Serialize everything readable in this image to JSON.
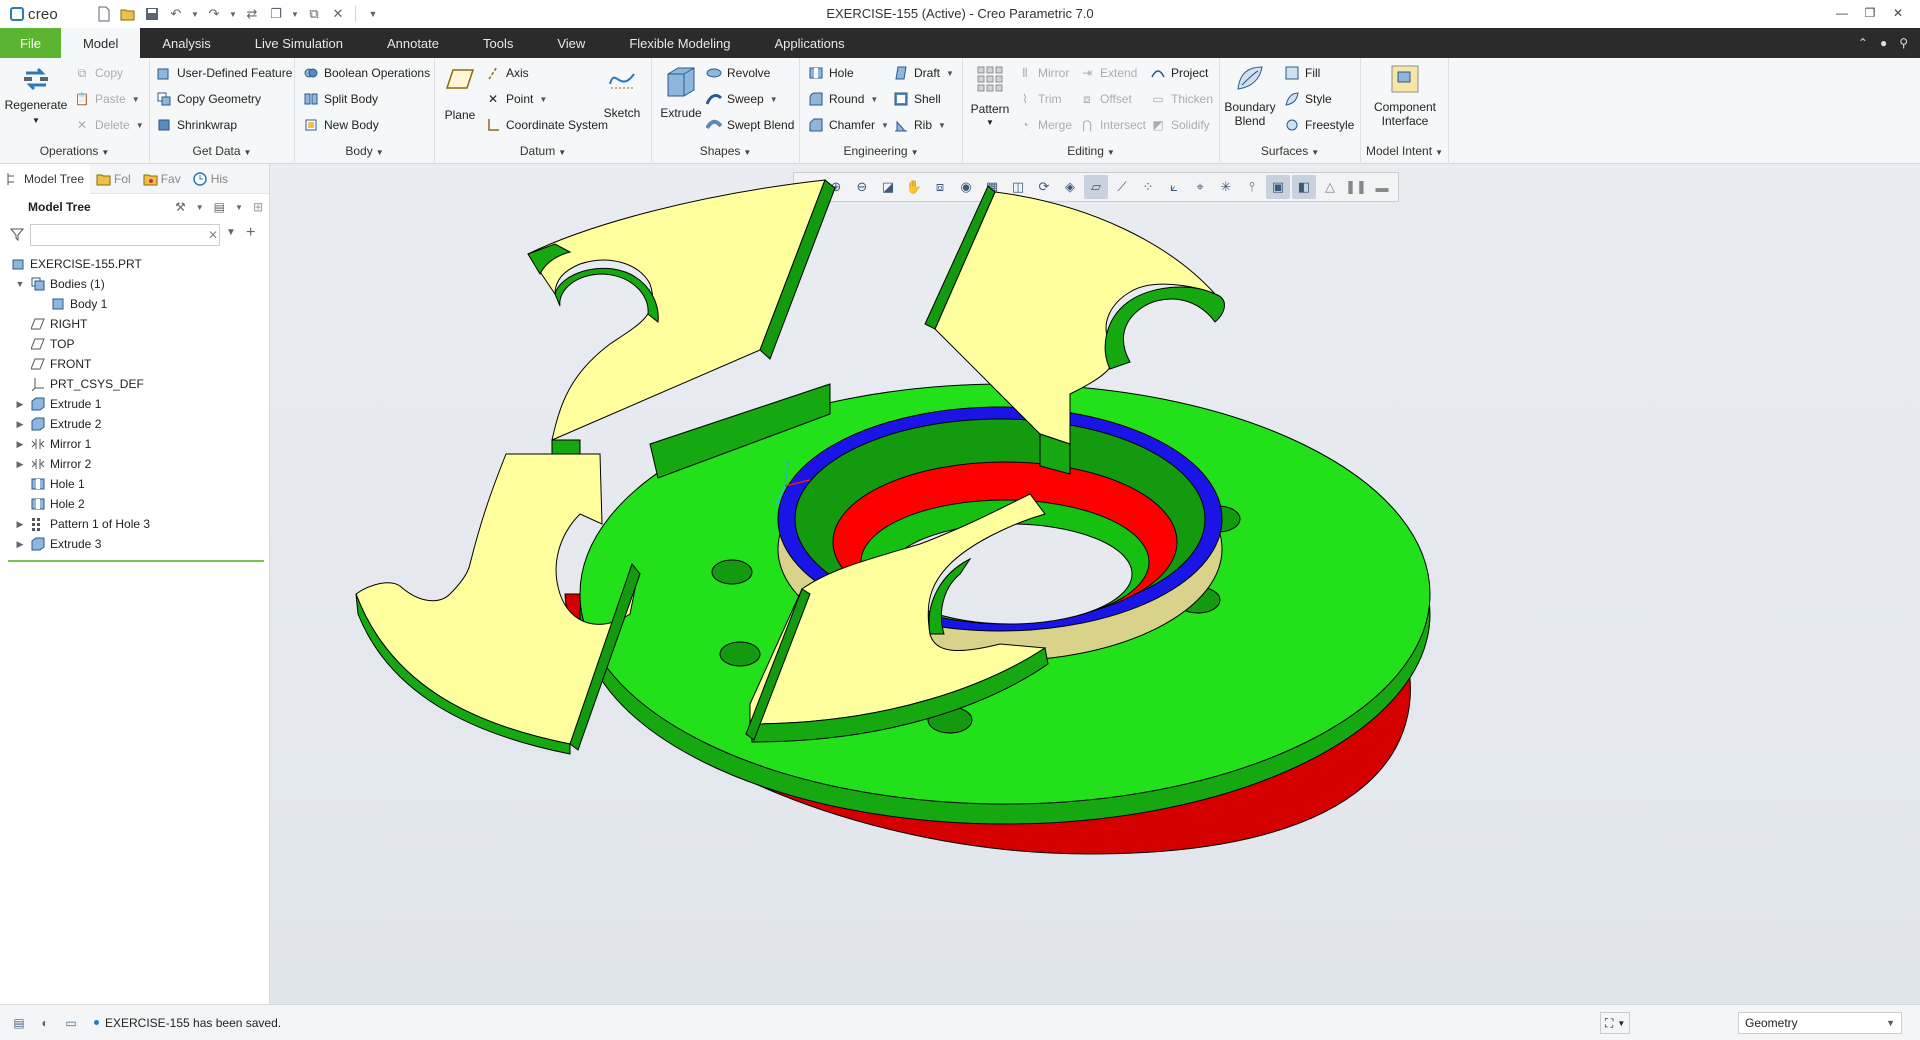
{
  "app": {
    "logo_text": "creo",
    "window_title": "EXERCISE-155 (Active) - Creo Parametric 7.0"
  },
  "menubar": {
    "tabs": [
      {
        "label": "File"
      },
      {
        "label": "Model"
      },
      {
        "label": "Analysis"
      },
      {
        "label": "Live Simulation"
      },
      {
        "label": "Annotate"
      },
      {
        "label": "Tools"
      },
      {
        "label": "View"
      },
      {
        "label": "Flexible Modeling"
      },
      {
        "label": "Applications"
      }
    ]
  },
  "ribbon": {
    "operations": {
      "label": "Operations",
      "regenerate": "Regenerate",
      "copy": "Copy",
      "paste": "Paste",
      "delete": "Delete"
    },
    "get_data": {
      "label": "Get Data",
      "user_defined_feature": "User-Defined Feature",
      "copy_geometry": "Copy Geometry",
      "shrinkwrap": "Shrinkwrap"
    },
    "body": {
      "label": "Body",
      "boolean_operations": "Boolean Operations",
      "split_body": "Split Body",
      "new_body": "New Body"
    },
    "datum": {
      "label": "Datum",
      "plane": "Plane",
      "axis": "Axis",
      "point": "Point",
      "coordinate_system": "Coordinate System",
      "sketch": "Sketch"
    },
    "shapes": {
      "label": "Shapes",
      "extrude": "Extrude",
      "revolve": "Revolve",
      "sweep": "Sweep",
      "swept_blend": "Swept Blend"
    },
    "engineering": {
      "label": "Engineering",
      "hole": "Hole",
      "round": "Round",
      "chamfer": "Chamfer",
      "draft": "Draft",
      "shell": "Shell",
      "rib": "Rib"
    },
    "editing": {
      "label": "Editing",
      "pattern": "Pattern",
      "mirror": "Mirror",
      "trim": "Trim",
      "merge": "Merge",
      "extend": "Extend",
      "offset": "Offset",
      "intersect": "Intersect",
      "project": "Project",
      "thicken": "Thicken",
      "solidify": "Solidify"
    },
    "surfaces": {
      "label": "Surfaces",
      "boundary_blend_1": "Boundary",
      "boundary_blend_2": "Blend",
      "fill": "Fill",
      "style": "Style",
      "freestyle": "Freestyle"
    },
    "model_intent": {
      "label": "Model Intent",
      "component_interface_1": "Component",
      "component_interface_2": "Interface"
    }
  },
  "panel": {
    "tabs": [
      {
        "label": "Model Tree"
      },
      {
        "label": "Fol"
      },
      {
        "label": "Fav"
      },
      {
        "label": "His"
      }
    ],
    "tree_title": "Model Tree",
    "filter_placeholder": "",
    "nodes": [
      {
        "label": "EXERCISE-155.PRT",
        "icon": "part-icon"
      },
      {
        "label": "Bodies (1)",
        "icon": "bodies-icon"
      },
      {
        "label": "Body 1",
        "icon": "body-icon"
      },
      {
        "label": "RIGHT",
        "icon": "datum-plane-icon"
      },
      {
        "label": "TOP",
        "icon": "datum-plane-icon"
      },
      {
        "label": "FRONT",
        "icon": "datum-plane-icon"
      },
      {
        "label": "PRT_CSYS_DEF",
        "icon": "csys-icon"
      },
      {
        "label": "Extrude 1",
        "icon": "extrude-icon"
      },
      {
        "label": "Extrude 2",
        "icon": "extrude-icon"
      },
      {
        "label": "Mirror 1",
        "icon": "mirror-icon"
      },
      {
        "label": "Mirror 2",
        "icon": "mirror-icon"
      },
      {
        "label": "Hole 1",
        "icon": "hole-icon"
      },
      {
        "label": "Hole 2",
        "icon": "hole-icon"
      },
      {
        "label": "Pattern 1 of Hole 3",
        "icon": "pattern-icon"
      },
      {
        "label": "Extrude 3",
        "icon": "extrude-icon"
      }
    ]
  },
  "status": {
    "message": "EXERCISE-155 has been saved.",
    "filter_value": "Geometry"
  },
  "colors": {
    "file_tab": "#5cb531",
    "menubar": "#2b2b2b",
    "model_green": "#22e01a",
    "model_yellow": "#ffff9e",
    "model_red": "#d40000",
    "model_blue": "#1a14e6",
    "model_dark_green": "#139a0e",
    "model_khaki": "#d9d28a"
  }
}
